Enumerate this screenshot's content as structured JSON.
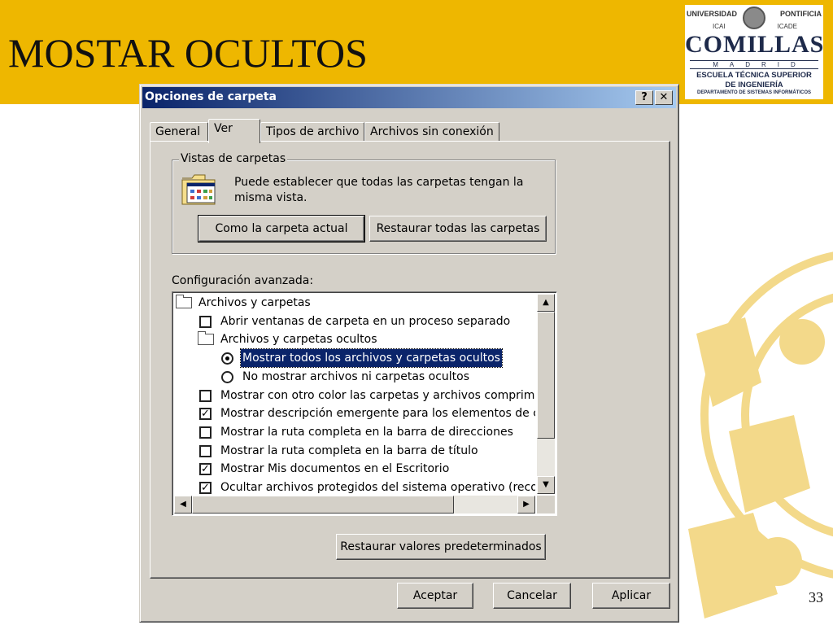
{
  "slide": {
    "title": "MOSTAR OCULTOS",
    "page_number": "33",
    "logo": {
      "universidad": "UNIVERSIDAD",
      "pontificia": "PONTIFICIA",
      "icai": "ICAI",
      "icade": "ICADE",
      "name": "COMILLAS",
      "city": "MADRID",
      "school_line1": "ESCUELA TÉCNICA SUPERIOR",
      "school_line2": "DE INGENIERÍA",
      "department": "DEPARTAMENTO DE SISTEMAS INFORMÁTICOS"
    },
    "colors": {
      "header": "#EEB700",
      "watermark": "#F3D98A"
    }
  },
  "dialog": {
    "title": "Opciones de carpeta",
    "help_label": "?",
    "close_label": "✕",
    "tabs": [
      {
        "label": "General"
      },
      {
        "label": "Ver"
      },
      {
        "label": "Tipos de archivo"
      },
      {
        "label": "Archivos sin conexión"
      }
    ],
    "active_tab": "Ver",
    "folder_views": {
      "legend": "Vistas de carpetas",
      "description": "Puede establecer que todas las carpetas tengan la misma vista.",
      "like_current_button": "Como la carpeta actual",
      "reset_all_button": "Restaurar todas las carpetas"
    },
    "advanced": {
      "label": "Configuración avanzada:",
      "items": [
        {
          "type": "folder",
          "indent": 0,
          "text": "Archivos y carpetas"
        },
        {
          "type": "checkbox",
          "indent": 1,
          "checked": false,
          "text": "Abrir ventanas de carpeta en un proceso separado"
        },
        {
          "type": "folder",
          "indent": 1,
          "text": "Archivos y carpetas ocultos"
        },
        {
          "type": "radio",
          "indent": 2,
          "checked": true,
          "selected": true,
          "text": "Mostrar todos los archivos y carpetas ocultos"
        },
        {
          "type": "radio",
          "indent": 2,
          "checked": false,
          "text": "No mostrar archivos ni carpetas ocultos"
        },
        {
          "type": "checkbox",
          "indent": 1,
          "checked": false,
          "text": "Mostrar con otro color las carpetas y archivos comprimido"
        },
        {
          "type": "checkbox",
          "indent": 1,
          "checked": true,
          "text": "Mostrar descripción emergente para los elementos de car"
        },
        {
          "type": "checkbox",
          "indent": 1,
          "checked": false,
          "text": "Mostrar la ruta completa en la barra de direcciones"
        },
        {
          "type": "checkbox",
          "indent": 1,
          "checked": false,
          "text": "Mostrar la ruta completa en la barra de título"
        },
        {
          "type": "checkbox",
          "indent": 1,
          "checked": true,
          "text": "Mostrar Mis documentos en el Escritorio"
        },
        {
          "type": "checkbox",
          "indent": 1,
          "checked": true,
          "text": "Ocultar archivos protegidos del sistema operativo (recome"
        }
      ]
    },
    "restore_defaults_button": "Restaurar valores predeterminados",
    "ok_button": "Aceptar",
    "cancel_button": "Cancelar",
    "apply_button": "Aplicar",
    "colors": {
      "titlebar_start": "#0A246A",
      "titlebar_end": "#A6CAF0",
      "face": "#D4D0C8",
      "selection": "#0A246A"
    }
  }
}
